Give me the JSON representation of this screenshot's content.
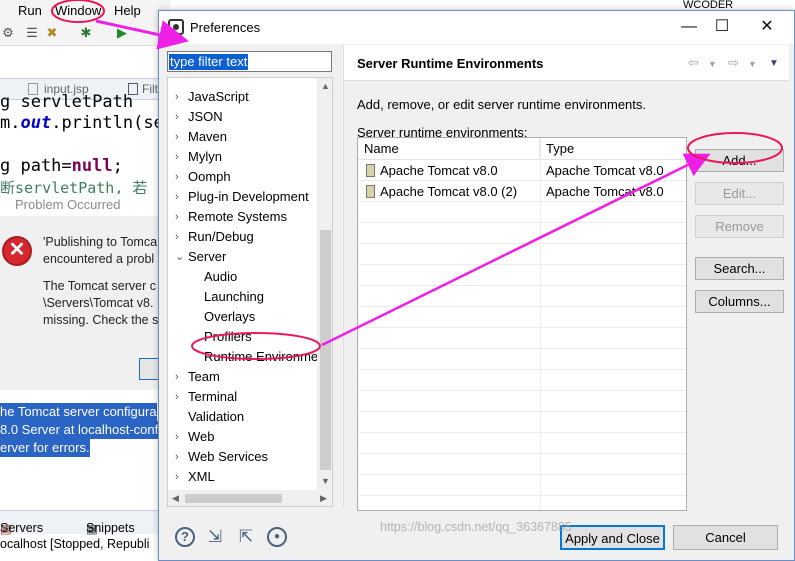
{
  "background": {
    "menu": [
      "Run",
      "Window",
      "Help"
    ],
    "editor_tabs": [
      "input.jsp",
      "Filt"
    ],
    "code_lines": [
      {
        "a": "g servletPath ",
        "b": ""
      },
      {
        "a": "m.",
        "b": "out",
        "c": ".println(se"
      },
      {
        "a": "g path=",
        "b": "null",
        "c": ";"
      },
      {
        "a": "断servletPath, 若"
      }
    ],
    "problem_title": "Problem Occurred",
    "problem_lines": [
      "'Publishing to Tomca",
      "encountered a probl",
      "The Tomcat server c",
      "\\Servers\\Tomcat v8.",
      "missing. Check the s"
    ],
    "console_lines": [
      "he Tomcat server configura",
      "8.0 Server at localhost-conf",
      "erver for errors."
    ],
    "bottom_tabs": [
      "Servers",
      "Snippets"
    ],
    "server_row": "ocalhost  [Stopped, Republi",
    "corner_text": "WCODER"
  },
  "dialog": {
    "title": "Preferences",
    "filter_text": "type filter text",
    "tree": [
      {
        "label": "JavaScript",
        "level": 0,
        "arrow": "›"
      },
      {
        "label": "JSON",
        "level": 0,
        "arrow": "›"
      },
      {
        "label": "Maven",
        "level": 0,
        "arrow": "›"
      },
      {
        "label": "Mylyn",
        "level": 0,
        "arrow": "›"
      },
      {
        "label": "Oomph",
        "level": 0,
        "arrow": "›"
      },
      {
        "label": "Plug-in Development",
        "level": 0,
        "arrow": "›"
      },
      {
        "label": "Remote Systems",
        "level": 0,
        "arrow": "›"
      },
      {
        "label": "Run/Debug",
        "level": 0,
        "arrow": "›"
      },
      {
        "label": "Server",
        "level": 0,
        "arrow": "⌄"
      },
      {
        "label": "Audio",
        "level": 1,
        "arrow": ""
      },
      {
        "label": "Launching",
        "level": 1,
        "arrow": ""
      },
      {
        "label": "Overlays",
        "level": 1,
        "arrow": ""
      },
      {
        "label": "Profilers",
        "level": 1,
        "arrow": ""
      },
      {
        "label": "Runtime Environme",
        "level": 1,
        "arrow": ""
      },
      {
        "label": "Team",
        "level": 0,
        "arrow": "›"
      },
      {
        "label": "Terminal",
        "level": 0,
        "arrow": "›"
      },
      {
        "label": "Validation",
        "level": 0,
        "arrow": ""
      },
      {
        "label": "Web",
        "level": 0,
        "arrow": "›"
      },
      {
        "label": "Web Services",
        "level": 0,
        "arrow": "›"
      },
      {
        "label": "XML",
        "level": 0,
        "arrow": "›"
      }
    ],
    "page_title": "Server Runtime Environments",
    "description": "Add, remove, or edit server runtime environments.",
    "table_label": "Server runtime environments:",
    "columns": [
      "Name",
      "Type"
    ],
    "rows": [
      {
        "name": "Apache Tomcat v8.0",
        "type": "Apache Tomcat v8.0"
      },
      {
        "name": "Apache Tomcat v8.0 (2)",
        "type": "Apache Tomcat v8.0"
      }
    ],
    "buttons": {
      "add": "Add...",
      "edit": "Edit...",
      "remove": "Remove",
      "search": "Search...",
      "columns": "Columns..."
    },
    "apply_close": "Apply and Close",
    "cancel": "Cancel",
    "watermark": "https://blog.csdn.net/qq_36367885"
  },
  "colors": {
    "annotation": "#e8185f",
    "arrow": "#ee20e8",
    "selection": "#0b5fd3"
  }
}
